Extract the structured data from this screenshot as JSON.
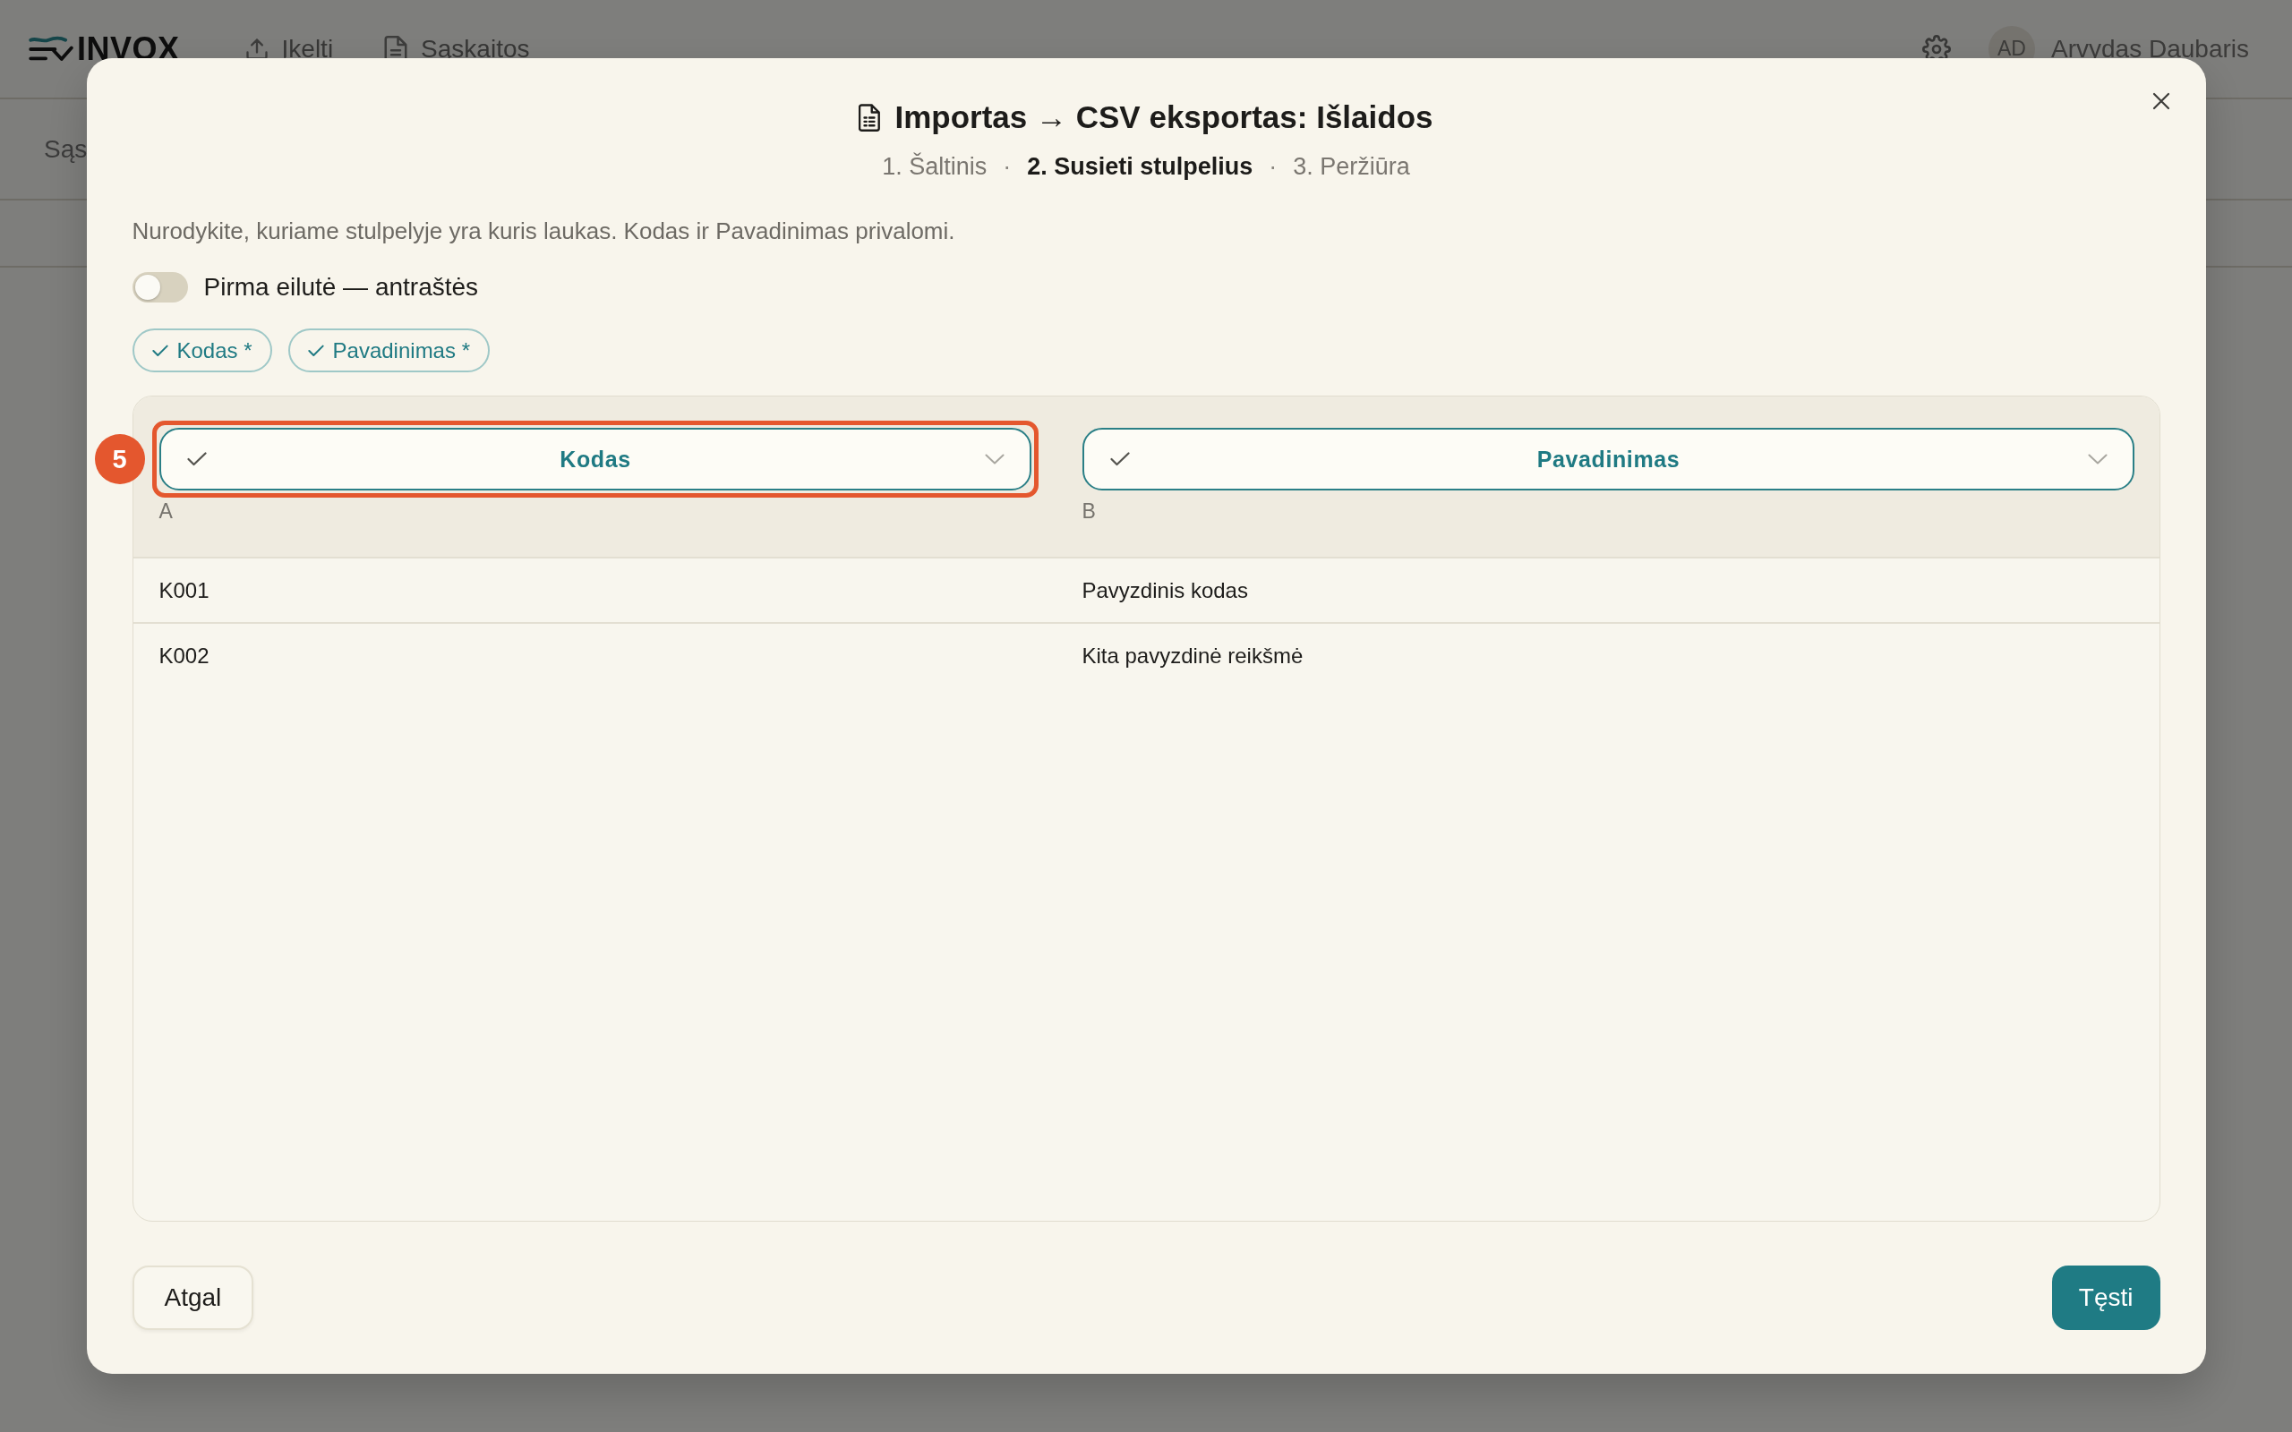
{
  "app_bar": {
    "logo": "INVOX",
    "nav": [
      {
        "label": "Įkelti"
      },
      {
        "label": "Sąskaitos"
      }
    ],
    "user": {
      "initials": "AD",
      "name": "Arvydas Daubaris"
    }
  },
  "subnav": {
    "label": "Sąs"
  },
  "dialog": {
    "title": "Importas → CSV eksportas: Išlaidos",
    "steps": [
      {
        "label": "1. Šaltinis",
        "selected": false
      },
      {
        "label": "2. Susieti stulpelius",
        "selected": true
      },
      {
        "label": "3. Peržiūra",
        "selected": false
      }
    ],
    "step_separators": [
      "·",
      "·"
    ],
    "description": "Nurodykite, kuriame stulpelyje yra kuris laukas. Kodas ir Pavadinimas privalomi.",
    "header_toggle": {
      "label": "Pirma eilutė — antraštės",
      "on": false
    },
    "required_fields": [
      {
        "label": "Kodas *",
        "checked": true
      },
      {
        "label": "Pavadinimas *",
        "checked": true
      }
    ],
    "table": {
      "columns": [
        {
          "mapping": "Kodas",
          "mapped": true,
          "letter": "A",
          "callout": "5"
        },
        {
          "mapping": "Pavadinimas",
          "mapped": true,
          "letter": "B"
        }
      ],
      "rows": [
        [
          "K001",
          "Pavyzdinis kodas"
        ],
        [
          "K002",
          "Kita pavyzdinė reikšmė"
        ]
      ]
    },
    "buttons": [
      {
        "label": "Atgal",
        "kind": "secondary"
      },
      {
        "label": "Tęsti",
        "kind": "primary"
      }
    ]
  }
}
